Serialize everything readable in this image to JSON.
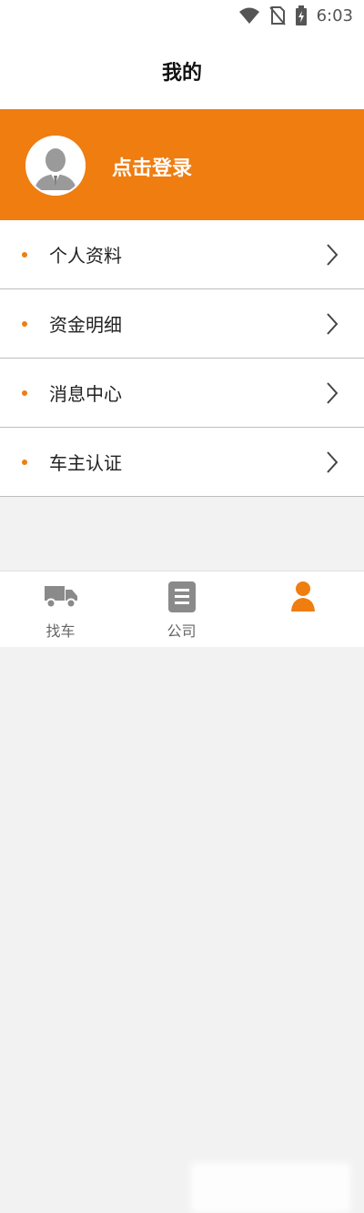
{
  "statusbar": {
    "time": "6:03"
  },
  "header": {
    "title": "我的"
  },
  "banner": {
    "login_label": "点击登录",
    "color": "#ef7d10"
  },
  "menu": {
    "items": [
      {
        "label": "个人资料"
      },
      {
        "label": "资金明细"
      },
      {
        "label": "消息中心"
      },
      {
        "label": "车主认证"
      }
    ]
  },
  "tabbar": {
    "tabs": [
      {
        "label": "找车",
        "icon": "truck-icon"
      },
      {
        "label": "公司",
        "icon": "document-icon"
      },
      {
        "label": "",
        "icon": "person-icon",
        "active": true
      }
    ],
    "active_color": "#ef7d10"
  }
}
